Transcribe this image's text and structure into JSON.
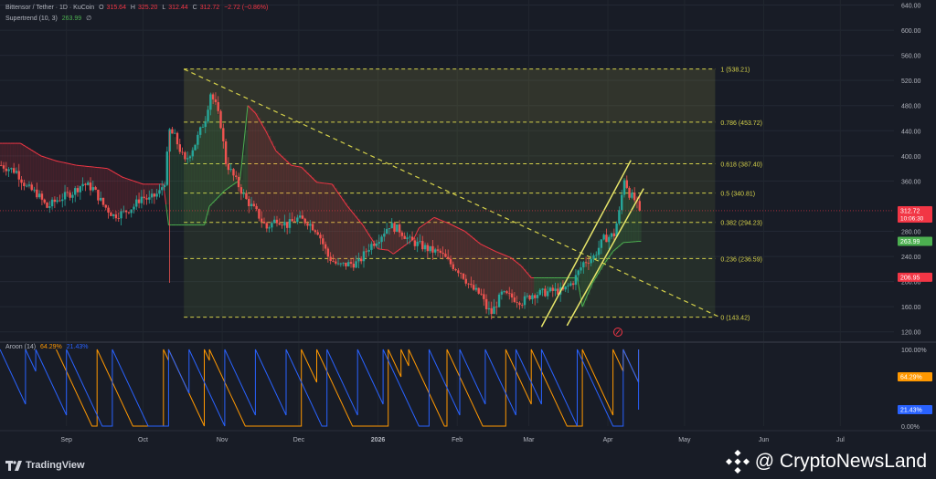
{
  "header": {
    "pair": "Bittensor / Tether · 1D · KuCoin",
    "o_label": "O",
    "o_value": "315.64",
    "h_label": "H",
    "h_value": "325.20",
    "l_label": "L",
    "l_value": "312.44",
    "c_label": "C",
    "c_value": "312.72",
    "change": "−2.72 (−0.86%)",
    "supertrend_label": "Supertrend (10, 3)",
    "supertrend_value": "263.99",
    "supertrend_tail": "∅"
  },
  "aroon_legend": {
    "label": "Aroon (14)",
    "up": "64.29%",
    "down": "21.43%"
  },
  "footer": {
    "logo_text": "TradingView",
    "watermark": "@ CryptoNewsLand"
  },
  "colors": {
    "background": "#181c26",
    "up_candle": "#26a69a",
    "down_candle": "#ef5350",
    "supertrend_up": "#4caf50",
    "supertrend_down": "#f23645",
    "fib_line": "#d4d04a",
    "channel": "#e8e66a",
    "aroon_up": "#ff9800",
    "aroon_down": "#2962ff"
  },
  "chart_data": [
    {
      "type": "candlestick",
      "title": "Bittensor / Tether · 1D · KuCoin",
      "y_ticks": [
        640,
        600,
        560,
        520,
        480,
        440,
        400,
        360,
        280,
        240,
        200,
        160,
        120
      ],
      "ylim": [
        108,
        648
      ],
      "x_ticks": [
        "Sep",
        "Oct",
        "Nov",
        "Dec",
        "2026",
        "Feb",
        "Mar",
        "Apr",
        "May",
        "Jun",
        "Jul"
      ],
      "x_tick_days": [
        26,
        56,
        87,
        117,
        148,
        179,
        207,
        238,
        268,
        299,
        329
      ],
      "x_range_days": [
        0,
        350
      ],
      "price_labels": [
        {
          "value": "312.72",
          "sub": "10:06:30",
          "price": 312.72,
          "color": "#f23645"
        },
        {
          "value": "263.99",
          "price": 263.99,
          "color": "#4caf50"
        },
        {
          "value": "206.95",
          "price": 206.95,
          "color": "#f23645"
        }
      ],
      "fibonacci": {
        "levels": [
          {
            "ratio": "1",
            "price": 538.21,
            "label": "1 (538.21)"
          },
          {
            "ratio": "0.786",
            "price": 453.72,
            "label": "0.786 (453.72)"
          },
          {
            "ratio": "0.618",
            "price": 387.4,
            "label": "0.618 (387.40)"
          },
          {
            "ratio": "0.5",
            "price": 340.81,
            "label": "0.5 (340.81)"
          },
          {
            "ratio": "0.382",
            "price": 294.23,
            "label": "0.382 (294.23)"
          },
          {
            "ratio": "0.236",
            "price": 236.59,
            "label": "0.236 (236.59)"
          },
          {
            "ratio": "0",
            "price": 143.42,
            "label": "0 (143.42)"
          }
        ],
        "start_day": 72,
        "end_day": 280
      },
      "trendline": {
        "from": {
          "day": 72,
          "price": 538
        },
        "to": {
          "day": 282,
          "price": 143
        }
      },
      "channel": [
        {
          "from": {
            "day": 212,
            "price": 128
          },
          "to": {
            "day": 247,
            "price": 393
          }
        },
        {
          "from": {
            "day": 222,
            "price": 130
          },
          "to": {
            "day": 252,
            "price": 348
          }
        }
      ],
      "supertrend": [
        {
          "day": 0,
          "v": 420
        },
        {
          "day": 8,
          "v": 420
        },
        {
          "day": 12,
          "v": 410
        },
        {
          "day": 16,
          "v": 400
        },
        {
          "day": 22,
          "v": 392
        },
        {
          "day": 30,
          "v": 385
        },
        {
          "day": 42,
          "v": 380
        },
        {
          "day": 48,
          "v": 366
        },
        {
          "day": 56,
          "v": 355
        },
        {
          "day": 64,
          "v": 355
        },
        {
          "day": 66,
          "v": 290
        },
        {
          "day": 80,
          "v": 290
        },
        {
          "day": 82,
          "v": 320
        },
        {
          "day": 88,
          "v": 345
        },
        {
          "day": 94,
          "v": 362
        },
        {
          "day": 97,
          "v": 480
        },
        {
          "day": 100,
          "v": 468
        },
        {
          "day": 104,
          "v": 440
        },
        {
          "day": 108,
          "v": 408
        },
        {
          "day": 114,
          "v": 385
        },
        {
          "day": 118,
          "v": 382
        },
        {
          "day": 124,
          "v": 358
        },
        {
          "day": 130,
          "v": 355
        },
        {
          "day": 136,
          "v": 320
        },
        {
          "day": 142,
          "v": 290
        },
        {
          "day": 148,
          "v": 252
        },
        {
          "day": 152,
          "v": 250
        },
        {
          "day": 154,
          "v": 244
        },
        {
          "day": 158,
          "v": 256
        },
        {
          "day": 162,
          "v": 268
        },
        {
          "day": 164,
          "v": 285
        },
        {
          "day": 170,
          "v": 302
        },
        {
          "day": 176,
          "v": 292
        },
        {
          "day": 182,
          "v": 280
        },
        {
          "day": 188,
          "v": 260
        },
        {
          "day": 194,
          "v": 248
        },
        {
          "day": 200,
          "v": 238
        },
        {
          "day": 204,
          "v": 225
        },
        {
          "day": 208,
          "v": 206
        },
        {
          "day": 220,
          "v": 206
        },
        {
          "day": 226,
          "v": 206
        },
        {
          "day": 228,
          "v": 160
        },
        {
          "day": 232,
          "v": 198
        },
        {
          "day": 236,
          "v": 225
        },
        {
          "day": 240,
          "v": 248
        },
        {
          "day": 244,
          "v": 262
        },
        {
          "day": 250,
          "v": 264
        }
      ],
      "supertrend_red_segments": [
        [
          0,
          64
        ],
        [
          97,
          208
        ]
      ],
      "candle_path": [
        {
          "day": 0,
          "p": 385
        },
        {
          "day": 6,
          "p": 375
        },
        {
          "day": 10,
          "p": 350
        },
        {
          "day": 14,
          "p": 340
        },
        {
          "day": 18,
          "p": 318
        },
        {
          "day": 22,
          "p": 330
        },
        {
          "day": 28,
          "p": 342
        },
        {
          "day": 32,
          "p": 356
        },
        {
          "day": 36,
          "p": 348
        },
        {
          "day": 40,
          "p": 322
        },
        {
          "day": 44,
          "p": 305
        },
        {
          "day": 48,
          "p": 310
        },
        {
          "day": 52,
          "p": 320
        },
        {
          "day": 55,
          "p": 335
        },
        {
          "day": 58,
          "p": 330
        },
        {
          "day": 62,
          "p": 342
        },
        {
          "day": 64,
          "p": 360
        },
        {
          "day": 66,
          "p": 440
        },
        {
          "day": 68,
          "p": 430
        },
        {
          "day": 70,
          "p": 410
        },
        {
          "day": 72,
          "p": 390
        },
        {
          "day": 76,
          "p": 420
        },
        {
          "day": 80,
          "p": 460
        },
        {
          "day": 82,
          "p": 500
        },
        {
          "day": 84,
          "p": 480
        },
        {
          "day": 86,
          "p": 450
        },
        {
          "day": 88,
          "p": 390
        },
        {
          "day": 92,
          "p": 360
        },
        {
          "day": 96,
          "p": 330
        },
        {
          "day": 100,
          "p": 310
        },
        {
          "day": 104,
          "p": 285
        },
        {
          "day": 108,
          "p": 300
        },
        {
          "day": 112,
          "p": 290
        },
        {
          "day": 116,
          "p": 300
        },
        {
          "day": 120,
          "p": 295
        },
        {
          "day": 124,
          "p": 280
        },
        {
          "day": 128,
          "p": 240
        },
        {
          "day": 132,
          "p": 225
        },
        {
          "day": 136,
          "p": 228
        },
        {
          "day": 140,
          "p": 230
        },
        {
          "day": 144,
          "p": 255
        },
        {
          "day": 148,
          "p": 270
        },
        {
          "day": 152,
          "p": 290
        },
        {
          "day": 156,
          "p": 282
        },
        {
          "day": 160,
          "p": 265
        },
        {
          "day": 164,
          "p": 258
        },
        {
          "day": 168,
          "p": 250
        },
        {
          "day": 172,
          "p": 245
        },
        {
          "day": 176,
          "p": 228
        },
        {
          "day": 180,
          "p": 215
        },
        {
          "day": 184,
          "p": 190
        },
        {
          "day": 188,
          "p": 178
        },
        {
          "day": 190,
          "p": 158
        },
        {
          "day": 192,
          "p": 150
        },
        {
          "day": 196,
          "p": 180
        },
        {
          "day": 200,
          "p": 175
        },
        {
          "day": 204,
          "p": 168
        },
        {
          "day": 208,
          "p": 180
        },
        {
          "day": 212,
          "p": 182
        },
        {
          "day": 216,
          "p": 185
        },
        {
          "day": 220,
          "p": 185
        },
        {
          "day": 224,
          "p": 200
        },
        {
          "day": 228,
          "p": 230
        },
        {
          "day": 232,
          "p": 240
        },
        {
          "day": 236,
          "p": 268
        },
        {
          "day": 240,
          "p": 275
        },
        {
          "day": 242,
          "p": 310
        },
        {
          "day": 244,
          "p": 365
        },
        {
          "day": 246,
          "p": 340
        },
        {
          "day": 248,
          "p": 330
        },
        {
          "day": 250,
          "p": 312.72
        }
      ]
    },
    {
      "type": "line",
      "title": "Aroon (14)",
      "y_ticks": [
        "100.00%",
        "0.00%"
      ],
      "ylim": [
        0,
        100
      ],
      "series": [
        {
          "name": "Aroon Up",
          "color": "#ff9800",
          "last": "64.29%"
        },
        {
          "name": "Aroon Down",
          "color": "#2962ff",
          "last": "21.43%"
        }
      ],
      "aroon_up_peaks": [
        22,
        38,
        64,
        66,
        80,
        82,
        118,
        124,
        152,
        157,
        160,
        175,
        198,
        208,
        228,
        240,
        244,
        250
      ],
      "aroon_down_peaks": [
        0,
        10,
        14,
        26,
        44,
        66,
        74,
        88,
        100,
        112,
        128,
        140,
        150,
        168,
        180,
        190,
        202,
        212,
        226,
        244,
        250
      ]
    }
  ]
}
